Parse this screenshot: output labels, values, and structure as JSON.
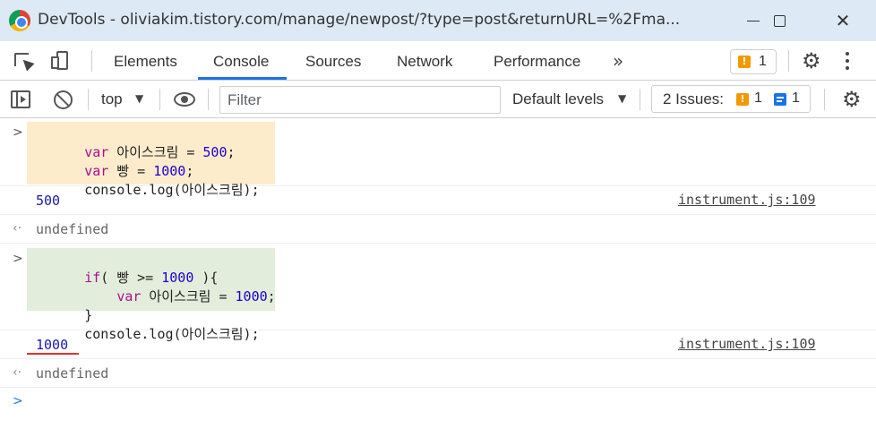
{
  "window": {
    "title": "DevTools - oliviakim.tistory.com/manage/newpost/?type=post&returnURL=%2Fma...",
    "minimize_icon": "minimize-icon",
    "maximize_icon": "maximize-icon",
    "close_glyph": "✕"
  },
  "tabs": [
    {
      "label": "Elements",
      "active": false
    },
    {
      "label": "Console",
      "active": true
    },
    {
      "label": "Sources",
      "active": false
    },
    {
      "label": "Network",
      "active": false
    },
    {
      "label": "Performance",
      "active": false
    }
  ],
  "more_tabs_glyph": "»",
  "toolbar_warnings": {
    "count": "1",
    "icon": "warning-icon"
  },
  "gear_glyph": "⚙",
  "console_toolbar": {
    "context": "top",
    "filter_placeholder": "Filter",
    "levels": "Default levels",
    "issues_label": "2 Issues:",
    "issues_warning_count": "1",
    "issues_info_count": "1"
  },
  "console": {
    "entries": [
      {
        "type": "input",
        "lines": [
          [
            {
              "t": "var",
              "c": "kw"
            },
            {
              "t": " 아이스크림 = ",
              "c": "plain"
            },
            {
              "t": "500",
              "c": "num"
            },
            {
              "t": ";",
              "c": "plain"
            }
          ],
          [
            {
              "t": "var",
              "c": "kw"
            },
            {
              "t": " 빵 = ",
              "c": "plain"
            },
            {
              "t": "1000",
              "c": "num"
            },
            {
              "t": ";",
              "c": "plain"
            }
          ],
          [
            {
              "t": "console.log(아이스크림);",
              "c": "plain"
            }
          ]
        ]
      },
      {
        "type": "log",
        "value": "500",
        "source": "instrument.js:109"
      },
      {
        "type": "return",
        "value": "undefined"
      },
      {
        "type": "input",
        "lines": [
          [
            {
              "t": "if",
              "c": "kw"
            },
            {
              "t": "( 빵 >= ",
              "c": "plain"
            },
            {
              "t": "1000",
              "c": "num"
            },
            {
              "t": " ){",
              "c": "plain"
            }
          ],
          [
            {
              "t": "    ",
              "c": "plain"
            },
            {
              "t": "var",
              "c": "kw"
            },
            {
              "t": " 아이스크림 = ",
              "c": "plain"
            },
            {
              "t": "1000",
              "c": "num"
            },
            {
              "t": ";",
              "c": "plain"
            }
          ],
          [
            {
              "t": "}",
              "c": "plain"
            }
          ],
          [
            {
              "t": "console.log(아이스크림);",
              "c": "plain"
            }
          ]
        ]
      },
      {
        "type": "log",
        "value": "1000",
        "source": "instrument.js:109"
      },
      {
        "type": "return",
        "value": "undefined"
      }
    ],
    "prompt_glyph": ">",
    "input_glyph": ">",
    "return_glyph": "‹·"
  },
  "colors": {
    "keyword": "#aa0d91",
    "number": "#1c00cf",
    "highlight_yellow": "#fdeccc",
    "highlight_green": "#e3eddb",
    "accent": "#1a73e8",
    "annotation_red": "#e23030"
  }
}
